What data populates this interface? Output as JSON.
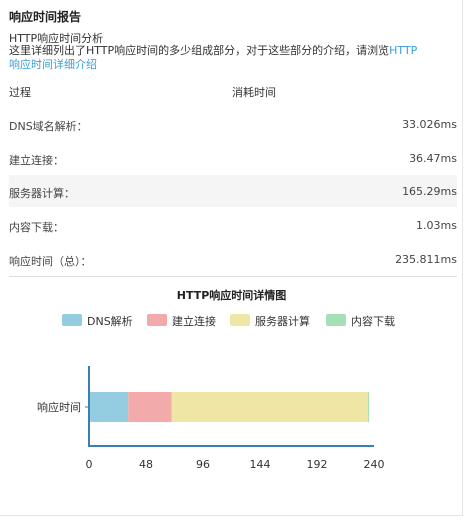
{
  "report": {
    "title": "响应时间报告",
    "subtitle": "HTTP响应时间分析",
    "desc_prefix": "这里详细列出了HTTP响应时间的多少组成部分，对于这些部分的介绍，请浏览",
    "desc_link_line1": "HTTP",
    "desc_link_line2": "响应时间详细介绍"
  },
  "table": {
    "col_process": "过程",
    "col_time": "消耗时间",
    "rows": [
      {
        "label": "DNS域名解析：",
        "value": "33.026ms"
      },
      {
        "label": "建立连接：",
        "value": "36.47ms"
      },
      {
        "label": "服务器计算：",
        "value": "165.29ms"
      },
      {
        "label": "内容下载：",
        "value": "1.03ms"
      },
      {
        "label": "响应时间（总）：",
        "value": "235.811ms"
      }
    ]
  },
  "colors": {
    "dns": "#94cde2",
    "connect": "#f2aaaa",
    "server": "#efe6a6",
    "download": "#a7dfb6",
    "axis": "#3a7fb0"
  },
  "chart_data": {
    "type": "bar",
    "orientation": "horizontal",
    "stacked": true,
    "title": "HTTP响应时间详情图",
    "categories": [
      "响应时间"
    ],
    "series": [
      {
        "name": "DNS解析",
        "values": [
          33.026
        ]
      },
      {
        "name": "建立连接",
        "values": [
          36.47
        ]
      },
      {
        "name": "服务器计算",
        "values": [
          165.29
        ]
      },
      {
        "name": "内容下载",
        "values": [
          1.03
        ]
      }
    ],
    "xlim": [
      0,
      240
    ],
    "xticks": [
      "0",
      "48",
      "96",
      "144",
      "192",
      "240"
    ],
    "legend": "top",
    "grid": false
  }
}
